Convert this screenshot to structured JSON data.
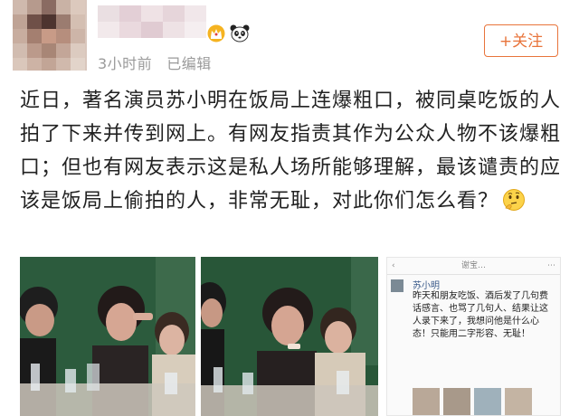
{
  "header": {
    "meta_time": "3小时前",
    "meta_edited": "已编辑",
    "follow_label": "+关注"
  },
  "post": {
    "text": "近日，著名演员苏小明在饭局上连爆粗口，被同桌吃饭的人拍了下来并传到网上。有网友指责其作为公众人物不该爆粗口；但也有网友表示这是私人场所能够理解，最该谴责的应该是饭局上偷拍的人，非常无耻，对此你们怎么看？",
    "emoji_icon": "thinking-face-icon"
  },
  "chat_card": {
    "top_left": "‹",
    "top_center": "谢宝…",
    "top_right": "⋯",
    "name": "苏小明",
    "text": "昨天和朋友吃饭、酒后发了几句费话感言、也骂了几句人、结果让这人录下来了，我想问他是什么心态！只能用二字形容、无耻！"
  },
  "colors": {
    "accent": "#e8743b",
    "meta": "#9a9a9a",
    "chat_name": "#3a5a8a"
  }
}
